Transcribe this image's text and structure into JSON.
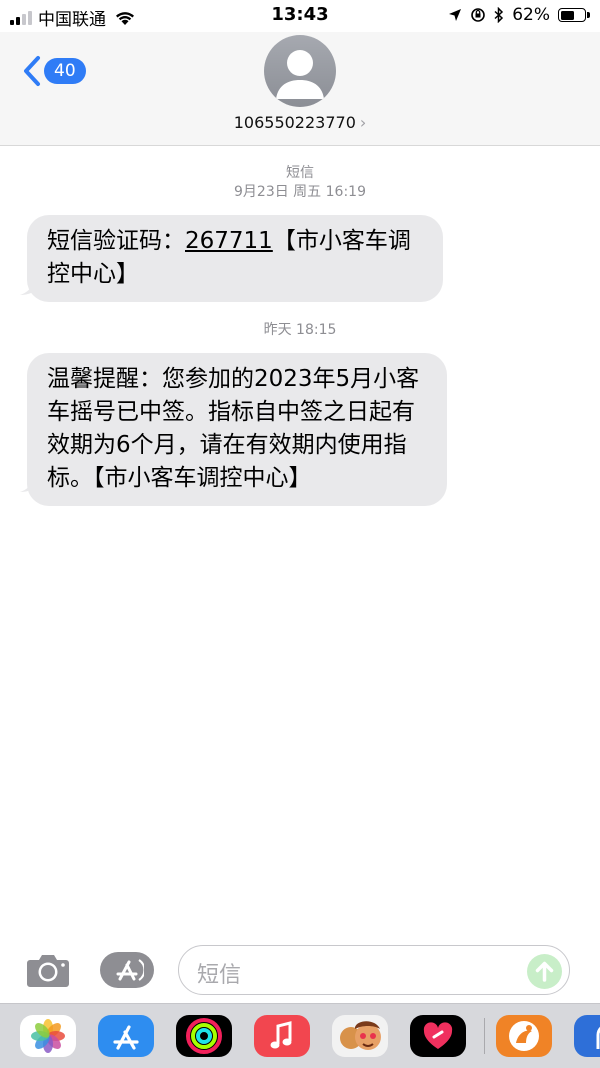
{
  "status_bar": {
    "carrier": "中国联通",
    "time": "13:43",
    "battery_percent": "62%",
    "battery_level": 0.62,
    "signal_bars": 2
  },
  "nav": {
    "back_count": "40",
    "contact_number": "106550223770",
    "chevron": "›"
  },
  "conversation": [
    {
      "channel": "短信",
      "timestamp": "9月23日 周五 16:19",
      "message_prefix": "短信验证码：",
      "message_code": "267711",
      "message_suffix": "【市小客车调控中心】"
    },
    {
      "timestamp": "昨天 18:15",
      "message": "温馨提醒：您参加的2023年5月小客车摇号已中签。指标自中签之日起有效期为6个月，请在有效期内使用指标。【市小客车调控中心】"
    }
  ],
  "input": {
    "placeholder": "短信"
  },
  "app_drawer": {
    "apps": [
      "photos-icon",
      "app-store-icon",
      "activity-icon",
      "music-icon",
      "memoji-icon",
      "digital-touch-icon",
      "third-party-app-icon",
      "partial-app-icon"
    ]
  },
  "colors": {
    "accent": "#2f7cf6",
    "bubble": "#e9e9eb",
    "nav_bg": "#f6f6f6",
    "drawer_bg": "#d7d8dc"
  }
}
